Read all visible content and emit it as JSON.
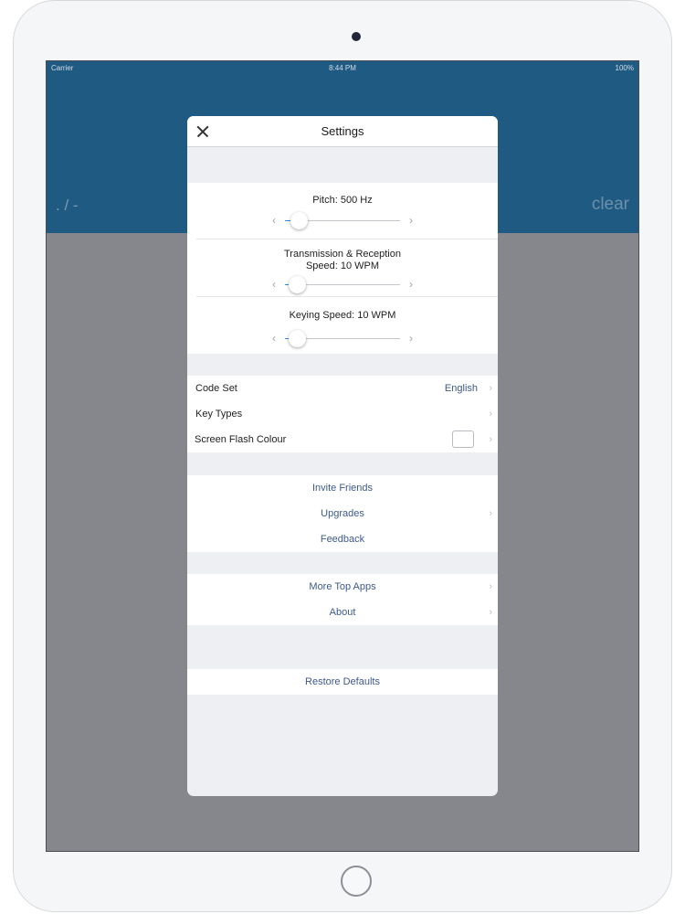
{
  "status_bar": {
    "carrier": "Carrier",
    "time": "8:44 PM",
    "battery": "100%"
  },
  "app": {
    "morse_display": ". / -",
    "clear_label": "clear"
  },
  "settings": {
    "title": "Settings",
    "sliders": [
      {
        "label": "Pitch: 500 Hz",
        "fraction": 0.12
      },
      {
        "label": "Transmission & Reception\nSpeed: 10 WPM",
        "fraction": 0.1
      },
      {
        "label": "Keying Speed: 10 WPM",
        "fraction": 0.1
      }
    ],
    "code_set": {
      "label": "Code Set",
      "value": "English"
    },
    "key_types": {
      "label": "Key Types"
    },
    "screen_flash": {
      "label": "Screen Flash Colour"
    },
    "invite_friends": "Invite Friends",
    "upgrades": "Upgrades",
    "feedback": "Feedback",
    "more_top_apps": "More Top Apps",
    "about": "About",
    "restore_defaults": "Restore Defaults"
  },
  "colors": {
    "header_blue": "#1f5a82",
    "link_blue": "#3d5a8a",
    "slider_fill": "#2d8ae6"
  }
}
